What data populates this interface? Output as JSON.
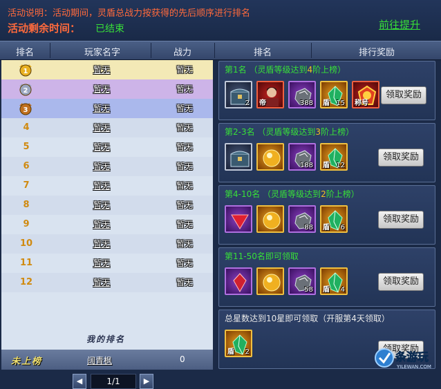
{
  "header": {
    "description": "活动说明：活动期间，灵盾总战力按获得的先后顺序进行排名",
    "remaining_label": "活动剩余时间：",
    "remaining_value": "已结束",
    "goto_label": "前往提升"
  },
  "columns": [
    "排名",
    "玩家名字",
    "战力",
    "排名",
    "排行奖励"
  ],
  "ranking": [
    {
      "rank": "1",
      "name": "暂无",
      "power": "暂无"
    },
    {
      "rank": "2",
      "name": "暂无",
      "power": "暂无"
    },
    {
      "rank": "3",
      "name": "暂无",
      "power": "暂无"
    },
    {
      "rank": "4",
      "name": "暂无",
      "power": "暂无"
    },
    {
      "rank": "5",
      "name": "暂无",
      "power": "暂无"
    },
    {
      "rank": "6",
      "name": "暂无",
      "power": "暂无"
    },
    {
      "rank": "7",
      "name": "暂无",
      "power": "暂无"
    },
    {
      "rank": "8",
      "name": "暂无",
      "power": "暂无"
    },
    {
      "rank": "9",
      "name": "暂无",
      "power": "暂无"
    },
    {
      "rank": "10",
      "name": "暂无",
      "power": "暂无"
    },
    {
      "rank": "11",
      "name": "暂无",
      "power": "暂无"
    },
    {
      "rank": "12",
      "name": "暂无",
      "power": "暂无"
    }
  ],
  "pager": {
    "page": "1/1",
    "prev_icon": "arrow-left-icon",
    "next_icon": "arrow-right-icon"
  },
  "my_rank_label": "我的排名",
  "my_row": {
    "status": "未上榜",
    "name": "阔青枫",
    "power": "0"
  },
  "rewards": [
    {
      "title_pre": "第1名 （灵盾等级达到",
      "title_num": "4",
      "title_post": "阶上榜）",
      "button": "领取奖励",
      "items": [
        {
          "icon": "treasure-chest-icon",
          "qty": "2"
        },
        {
          "icon": "portrait-card-icon",
          "qty": "",
          "tag": "帝"
        },
        {
          "icon": "iron-ore-icon",
          "qty": "388"
        },
        {
          "icon": "green-crystal-icon",
          "qty": "15",
          "tag": "盾"
        },
        {
          "icon": "fire-emblem-icon",
          "qty": "",
          "tag": "称号"
        }
      ]
    },
    {
      "title_pre": "第2-3名 （灵盾等级达到",
      "title_num": "3",
      "title_post": "阶上榜）",
      "button": "领取奖励",
      "items": [
        {
          "icon": "treasure-chest-icon",
          "qty": ""
        },
        {
          "icon": "golden-orb-icon",
          "qty": ""
        },
        {
          "icon": "iron-ore-icon",
          "qty": "188"
        },
        {
          "icon": "green-crystal-icon",
          "qty": "12",
          "tag": "盾"
        }
      ]
    },
    {
      "title_pre": "第4-10名 （灵盾等级达到",
      "title_num": "2",
      "title_post": "阶上榜）",
      "button": "领取奖励",
      "items": [
        {
          "icon": "red-triangle-gem-icon",
          "qty": ""
        },
        {
          "icon": "golden-orb-icon",
          "qty": ""
        },
        {
          "icon": "iron-ore-icon",
          "qty": "88"
        },
        {
          "icon": "green-crystal-icon",
          "qty": "6",
          "tag": "盾"
        }
      ]
    },
    {
      "title_pre": "第11-50名即可领取",
      "title_num": "",
      "title_post": "",
      "button": "领取奖励",
      "items": [
        {
          "icon": "red-gem-icon",
          "qty": ""
        },
        {
          "icon": "golden-orb-icon",
          "qty": ""
        },
        {
          "icon": "iron-ore-icon",
          "qty": "58"
        },
        {
          "icon": "green-crystal-icon",
          "qty": "4",
          "tag": "盾"
        }
      ]
    },
    {
      "title_pre": "总星数达到10星即可领取（开服第4天领取）",
      "title_num": "",
      "title_post": "",
      "button": "领取奖励",
      "items": [
        {
          "icon": "green-crystal-icon",
          "qty": "2",
          "tag": "盾"
        }
      ]
    }
  ],
  "watermark": {
    "text": "条游玩",
    "sub": "YILEWAN.COM"
  },
  "colors": {
    "gold_row": "#f3e9b6",
    "silver_row": "#cdb4e8",
    "bronze_row": "#aab8ec",
    "title_green": "#38e038",
    "title_num": "#f0c020"
  }
}
